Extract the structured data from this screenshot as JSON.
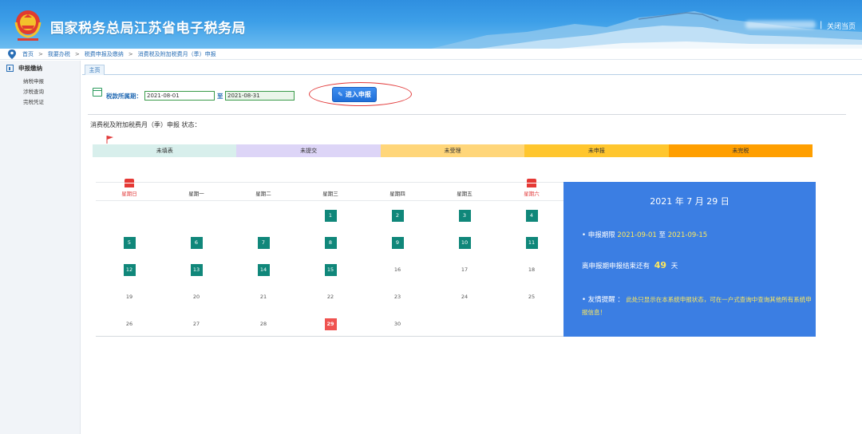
{
  "header": {
    "site_title": "国家税务总局江苏省电子税务局",
    "separator": "|",
    "close_label": "关闭当页"
  },
  "breadcrumb": {
    "items": [
      "首页",
      "我要办税",
      "税费申报及缴纳",
      "消费税及附加税费月（季）申报"
    ],
    "separator": ">"
  },
  "sidebar": {
    "section_title": "申报缴纳",
    "items": [
      "纳税申报",
      "涉税查询",
      "完税凭证"
    ]
  },
  "tab": {
    "label": "主页"
  },
  "period": {
    "label": "税款所属期：",
    "from_value": "2021-08-01",
    "to_label": "至",
    "to_value": "2021-08-31",
    "enter_button": "进入申报"
  },
  "status": {
    "title": "消费税及附加税费月（季）申报 状态：",
    "segments": [
      {
        "label": "未填表",
        "color": "#d8efec"
      },
      {
        "label": "未提交",
        "color": "#ddd5f7"
      },
      {
        "label": "未受理",
        "color": "#ffd67a"
      },
      {
        "label": "未申报",
        "color": "#ffc62e"
      },
      {
        "label": "未完税",
        "color": "#ff9f00"
      }
    ]
  },
  "calendar": {
    "weekdays": [
      "星期日",
      "星期一",
      "星期二",
      "星期三",
      "星期四",
      "星期五",
      "星期六"
    ],
    "first_weekday": 3,
    "days_in_month": 30,
    "highlighted_days": [
      1,
      2,
      3,
      4,
      5,
      6,
      7,
      8,
      9,
      10,
      11,
      12,
      13,
      14,
      15
    ],
    "today": 29,
    "accent_color": "#10877a"
  },
  "info": {
    "date_title": "2021 年 7 月 29 日",
    "deadline_label": "• 申报期限",
    "deadline_from": "2021-09-01",
    "deadline_to_label": "至",
    "deadline_to": "2021-09-15",
    "countdown_prefix": "离申报期申报结束还有",
    "countdown_days": "49",
    "countdown_suffix": "天",
    "tip_title": "• 友情提醒 ：",
    "tip_text": "此处只显示在本系统申报状态，可在一户式查询中查询其他所有系统申报信息！"
  }
}
